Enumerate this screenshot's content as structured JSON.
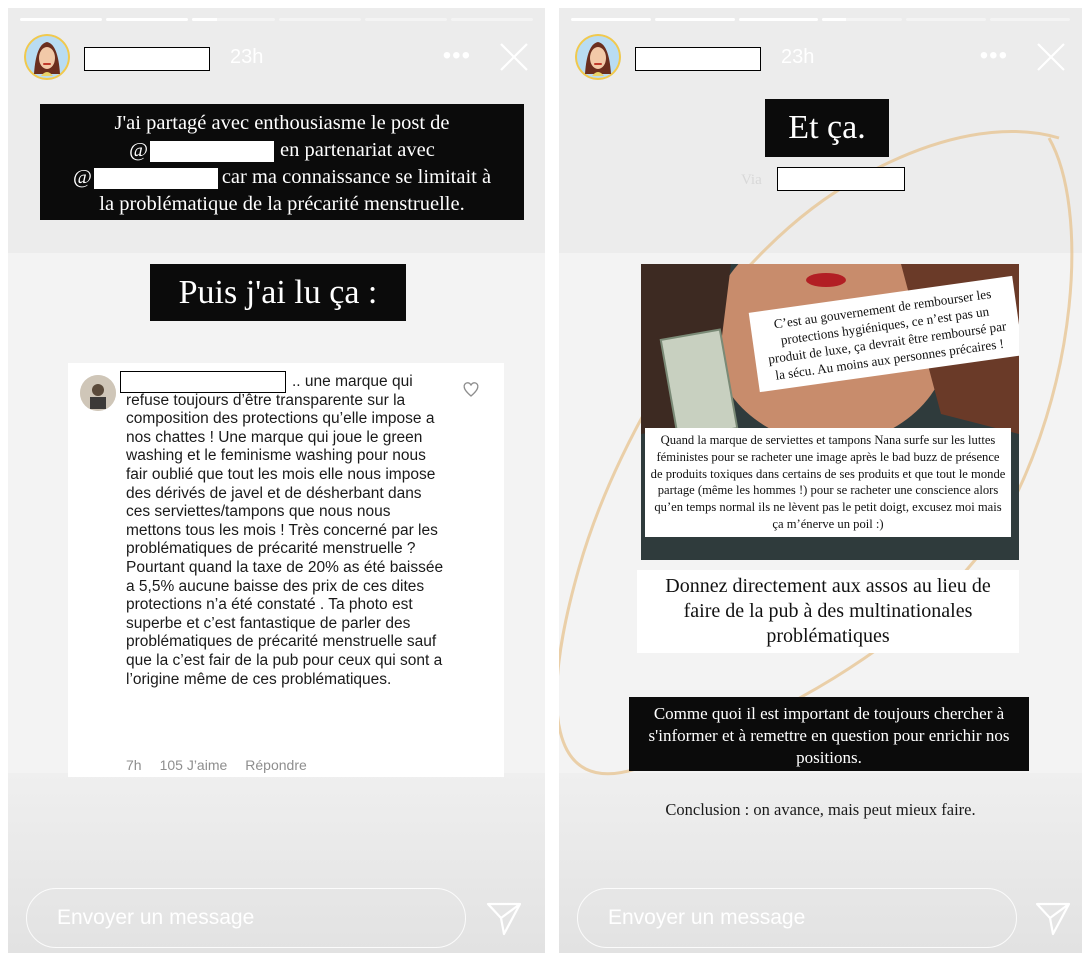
{
  "left_story": {
    "time": "23h",
    "more": "•••",
    "text_block_1": {
      "line1": "J'ai partagé avec enthousiasme le post de",
      "line2_prefix": "@",
      "line2_suffix": "en partenariat avec",
      "line3_prefix": "@",
      "line3_suffix": "car ma connaissance se limitait à",
      "line4": "la problématique de la précarité menstruelle."
    },
    "heading": "Puis j'ai lu ça :",
    "comment": {
      "text": ".. une marque qui refuse toujours d’être transparente sur la composition des protections qu’elle impose a nos chattes ! Une marque qui joue le green washing et le feminisme washing pour nous fair oublié que tout les mois elle nous impose des dérivés de javel et de désherbant dans ces serviettes/tampons que nous nous mettons tous les mois ! Très concerné par les problématiques de précarité menstruelle ? Pourtant quand la taxe de 20% as été baissée a 5,5% aucune baisse des prix de ces dites protections n’a été constaté . Ta photo est superbe et c’est fantastique de parler des problématiques de précarité menstruelle sauf que la c’est fair de la pub pour ceux qui sont a l’origine même de ces problématiques.",
      "time": "7h",
      "likes": "105 J’aime",
      "reply": "Répondre"
    },
    "message_placeholder": "Envoyer un message",
    "progress": [
      1,
      1,
      0.3,
      0,
      0,
      0
    ]
  },
  "right_story": {
    "time": "23h",
    "more": "•••",
    "heading": "Et ça.",
    "via": "Via",
    "image_quote": "C’est au gouvernement de rembourser les protections hygiéniques, ce n’est pas un produit de luxe, ça devrait être remboursé par la sécu. Au moins aux personnes précaires !",
    "image_caption": "Quand la marque de serviettes et tampons Nana surfe sur les luttes féministes pour se racheter une image après le bad buzz de présence de produits toxiques dans certains de ses produits et que tout le monde partage (même les hommes !) pour se racheter une conscience alors qu’en temps normal ils ne lèvent pas le petit doigt, excusez moi mais ça m’énerve un poil :)",
    "donate_text": "Donnez directement aux assos au lieu de faire de la pub à des multinationales problématiques",
    "important_text": "Comme quoi il est important de toujours chercher à s'informer et à remettre en question pour enrichir nos positions.",
    "conclusion": "Conclusion : on avance, mais peut mieux faire.",
    "message_placeholder": "Envoyer un message",
    "progress": [
      1,
      1,
      1,
      0.3,
      0,
      0
    ]
  },
  "colors": {
    "text_block_bg": "#0b0b0b",
    "arc": "#e8c89a",
    "meta_gray": "#8e8e8e"
  }
}
